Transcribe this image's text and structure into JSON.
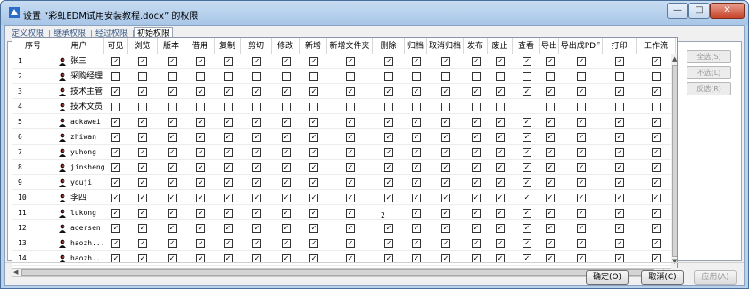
{
  "window": {
    "title": "设置 “彩虹EDM试用安装教程.docx” 的权限",
    "controls": {
      "minimize": "—",
      "maximize": "□",
      "close": "✕"
    }
  },
  "tabs": [
    "定义权限",
    "继承权限",
    "经过权限",
    "初始权限"
  ],
  "active_tab": "初始权限",
  "columns": [
    "序号",
    "用户",
    "可见",
    "浏览",
    "版本",
    "借用",
    "复制",
    "剪切",
    "修改",
    "新增",
    "新增文件夹",
    "删除",
    "归档",
    "取消归档",
    "发布",
    "废止",
    "查看",
    "导出",
    "导出成PDF",
    "打印",
    "工作流"
  ],
  "rows": [
    {
      "no": "1",
      "user": "张三",
      "cn": true,
      "perms": [
        1,
        1,
        1,
        1,
        1,
        1,
        1,
        1,
        1,
        1,
        1,
        1,
        1,
        1,
        1,
        1,
        1,
        1,
        1
      ]
    },
    {
      "no": "2",
      "user": "采购经理",
      "cn": true,
      "perms": [
        0,
        0,
        0,
        0,
        0,
        0,
        0,
        0,
        0,
        0,
        0,
        0,
        0,
        0,
        0,
        0,
        0,
        0,
        0
      ]
    },
    {
      "no": "3",
      "user": "技术主管",
      "cn": true,
      "perms": [
        1,
        1,
        1,
        1,
        1,
        1,
        1,
        1,
        1,
        1,
        1,
        1,
        1,
        1,
        1,
        1,
        1,
        1,
        1
      ]
    },
    {
      "no": "4",
      "user": "技术文员",
      "cn": true,
      "perms": [
        0,
        0,
        0,
        0,
        0,
        0,
        0,
        0,
        0,
        0,
        0,
        0,
        0,
        0,
        0,
        0,
        0,
        0,
        0
      ]
    },
    {
      "no": "5",
      "user": "aokawei",
      "cn": false,
      "perms": [
        1,
        1,
        1,
        1,
        1,
        1,
        1,
        1,
        1,
        1,
        1,
        1,
        1,
        1,
        1,
        1,
        1,
        1,
        1
      ]
    },
    {
      "no": "6",
      "user": "zhiwan",
      "cn": false,
      "perms": [
        1,
        1,
        1,
        1,
        1,
        1,
        1,
        1,
        1,
        1,
        1,
        1,
        1,
        1,
        1,
        1,
        1,
        1,
        1
      ]
    },
    {
      "no": "7",
      "user": "yuhong",
      "cn": false,
      "perms": [
        1,
        1,
        1,
        1,
        1,
        1,
        1,
        1,
        1,
        1,
        1,
        1,
        1,
        1,
        1,
        1,
        1,
        1,
        1
      ]
    },
    {
      "no": "8",
      "user": "jinsheng",
      "cn": false,
      "perms": [
        1,
        1,
        1,
        1,
        1,
        1,
        1,
        1,
        1,
        1,
        1,
        1,
        1,
        1,
        1,
        1,
        1,
        1,
        1
      ]
    },
    {
      "no": "9",
      "user": "youji",
      "cn": false,
      "perms": [
        1,
        1,
        1,
        1,
        1,
        1,
        1,
        1,
        1,
        1,
        1,
        1,
        1,
        1,
        1,
        1,
        1,
        1,
        1
      ]
    },
    {
      "no": "10",
      "user": "李四",
      "cn": true,
      "perms": [
        1,
        1,
        1,
        1,
        1,
        1,
        1,
        1,
        1,
        1,
        1,
        1,
        1,
        1,
        1,
        1,
        1,
        1,
        1
      ]
    },
    {
      "no": "11",
      "user": "lukong",
      "cn": false,
      "perms": [
        1,
        1,
        1,
        1,
        1,
        1,
        1,
        1,
        1,
        2,
        1,
        1,
        1,
        1,
        1,
        1,
        1,
        1,
        1
      ]
    },
    {
      "no": "12",
      "user": "aoersen",
      "cn": false,
      "perms": [
        1,
        1,
        1,
        1,
        1,
        1,
        1,
        1,
        1,
        1,
        1,
        1,
        1,
        1,
        1,
        1,
        1,
        1,
        1
      ]
    },
    {
      "no": "13",
      "user": "haozh...",
      "cn": false,
      "perms": [
        1,
        1,
        1,
        1,
        1,
        1,
        1,
        1,
        1,
        1,
        1,
        1,
        1,
        1,
        1,
        1,
        1,
        1,
        1
      ]
    },
    {
      "no": "14",
      "user": "haozh...",
      "cn": false,
      "perms": [
        1,
        1,
        1,
        1,
        1,
        1,
        1,
        1,
        1,
        1,
        1,
        1,
        1,
        1,
        1,
        1,
        1,
        1,
        1
      ]
    }
  ],
  "side_buttons": [
    "全选(S)",
    "不选(L)",
    "反选(R)"
  ],
  "buttons": {
    "ok": "确定(O)",
    "cancel": "取消(C)",
    "apply": "应用(A)"
  },
  "colors": {
    "titlebar": "#b9d1ea",
    "panel": "#f0f0f0",
    "check": "#000000"
  }
}
